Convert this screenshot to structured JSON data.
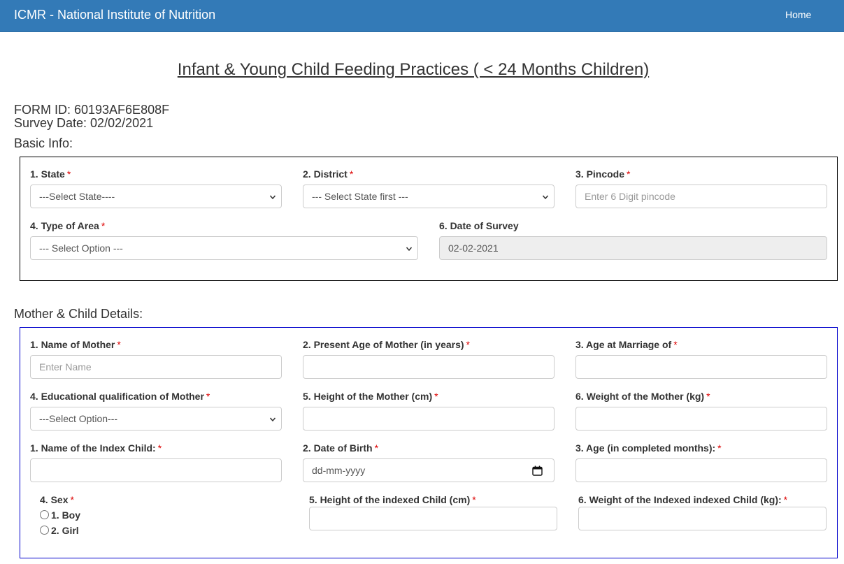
{
  "nav": {
    "brand": "ICMR - National Institute of Nutrition",
    "home": "Home"
  },
  "page": {
    "title": "Infant & Young Child Feeding Practices ( < 24 Months Children)",
    "form_id": "FORM ID: 60193AF6E808F",
    "survey_date": "Survey Date: 02/02/2021"
  },
  "basic": {
    "heading": "Basic Info:",
    "state_label": "1. State",
    "state_value": "---Select State----",
    "district_label": "2. District",
    "district_value": "--- Select State first ---",
    "pincode_label": "3. Pincode",
    "pincode_placeholder": "Enter 6 Digit pincode",
    "area_label": "4. Type of Area",
    "area_value": "--- Select Option ---",
    "date_label": "6. Date of Survey",
    "date_value": "02-02-2021"
  },
  "mother": {
    "heading": "Mother & Child Details:",
    "name_label": "1. Name of Mother",
    "name_placeholder": "Enter Name",
    "age_label": "2. Present Age of Mother (in years)",
    "marriage_label": "3. Age at Marriage of",
    "edu_label": "4. Educational qualification of Mother",
    "edu_value": "---Select Option---",
    "height_label": "5. Height of the Mother (cm)",
    "weight_label": "6. Weight of the Mother (kg)"
  },
  "child": {
    "name_label": "1. Name of the Index Child:",
    "dob_label": "2. Date of Birth",
    "dob_placeholder": "dd-mm-yyyy",
    "age_label": "3. Age (in completed months):",
    "sex_label": "4. Sex",
    "sex_options": [
      "1. Boy",
      "2. Girl"
    ],
    "height_label": "5. Height of the indexed Child (cm)",
    "weight_label": "6. Weight of the Indexed indexed Child (kg):"
  },
  "required_mark": "*",
  "colors": {
    "navbar": "#337ab7",
    "required": "#dd0000",
    "panel_blue_border": "#0000cc"
  }
}
